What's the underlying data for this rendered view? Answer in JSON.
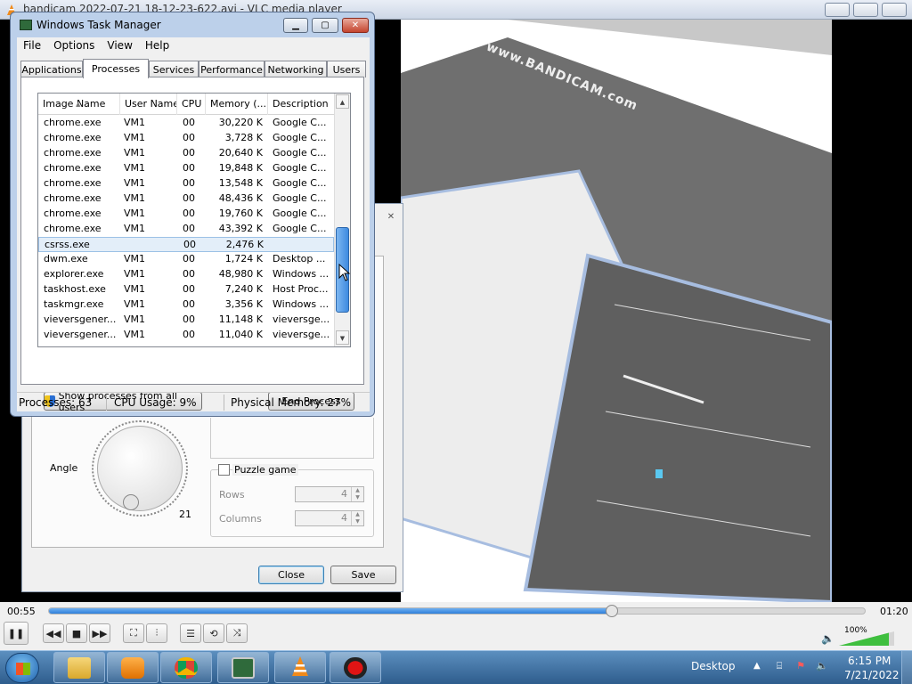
{
  "vlc": {
    "title": "bandicam 2022-07-21 18-12-23-622.avi - VLC media player",
    "time_current": "00:55",
    "time_total": "01:20",
    "seek_fraction": 0.69,
    "volume_percent": "100%",
    "watermark": "www.BANDICAM.com"
  },
  "adjust_dialog": {
    "close_symbol": "✕",
    "angle_label": "Angle",
    "angle_value": "21",
    "puzzle_label": "Puzzle game",
    "rows_label": "Rows",
    "rows_value": "4",
    "columns_label": "Columns",
    "columns_value": "4",
    "close_button": "Close",
    "save_button": "Save"
  },
  "task_manager": {
    "title": "Windows Task Manager",
    "menu": [
      "File",
      "Options",
      "View",
      "Help"
    ],
    "tabs": [
      "Applications",
      "Processes",
      "Services",
      "Performance",
      "Networking",
      "Users"
    ],
    "active_tab": "Processes",
    "columns": [
      "Image Name",
      "User Name",
      "CPU",
      "Memory (...",
      "Description"
    ],
    "rows": [
      {
        "name": "chrome.exe",
        "user": "VM1",
        "cpu": "00",
        "mem": "30,220 K",
        "desc": "Google C..."
      },
      {
        "name": "chrome.exe",
        "user": "VM1",
        "cpu": "00",
        "mem": "3,728 K",
        "desc": "Google C..."
      },
      {
        "name": "chrome.exe",
        "user": "VM1",
        "cpu": "00",
        "mem": "20,640 K",
        "desc": "Google C..."
      },
      {
        "name": "chrome.exe",
        "user": "VM1",
        "cpu": "00",
        "mem": "19,848 K",
        "desc": "Google C..."
      },
      {
        "name": "chrome.exe",
        "user": "VM1",
        "cpu": "00",
        "mem": "13,548 K",
        "desc": "Google C..."
      },
      {
        "name": "chrome.exe",
        "user": "VM1",
        "cpu": "00",
        "mem": "48,436 K",
        "desc": "Google C..."
      },
      {
        "name": "chrome.exe",
        "user": "VM1",
        "cpu": "00",
        "mem": "19,760 K",
        "desc": "Google C..."
      },
      {
        "name": "chrome.exe",
        "user": "VM1",
        "cpu": "00",
        "mem": "43,392 K",
        "desc": "Google C..."
      },
      {
        "name": "csrss.exe",
        "user": "",
        "cpu": "00",
        "mem": "2,476 K",
        "desc": "",
        "selected": true
      },
      {
        "name": "dwm.exe",
        "user": "VM1",
        "cpu": "00",
        "mem": "1,724 K",
        "desc": "Desktop ..."
      },
      {
        "name": "explorer.exe",
        "user": "VM1",
        "cpu": "00",
        "mem": "48,980 K",
        "desc": "Windows ..."
      },
      {
        "name": "taskhost.exe",
        "user": "VM1",
        "cpu": "00",
        "mem": "7,240 K",
        "desc": "Host Proc..."
      },
      {
        "name": "taskmgr.exe",
        "user": "VM1",
        "cpu": "00",
        "mem": "3,356 K",
        "desc": "Windows ..."
      },
      {
        "name": "vieversgener...",
        "user": "VM1",
        "cpu": "00",
        "mem": "11,148 K",
        "desc": "vieversge..."
      },
      {
        "name": "vieversgener...",
        "user": "VM1",
        "cpu": "00",
        "mem": "11,040 K",
        "desc": "vieversge..."
      }
    ],
    "show_all_button": "Show processes from all users",
    "end_process_button": "End Process",
    "status_processes": "Processes: 63",
    "status_cpu": "CPU Usage: 9%",
    "status_memory": "Physical Memory: 27%"
  },
  "taskbar": {
    "desktop_label": "Desktop",
    "clock_time": "6:15 PM",
    "clock_date": "7/21/2022",
    "apps": [
      "explorer-icon",
      "media-player-icon",
      "chrome-icon",
      "task-manager-icon",
      "vlc-icon",
      "recorder-icon"
    ]
  },
  "colors": {
    "accent": "#3e8ae0",
    "taskbar": "#2e5d8d",
    "seek_fill": "#2f7fd9"
  }
}
